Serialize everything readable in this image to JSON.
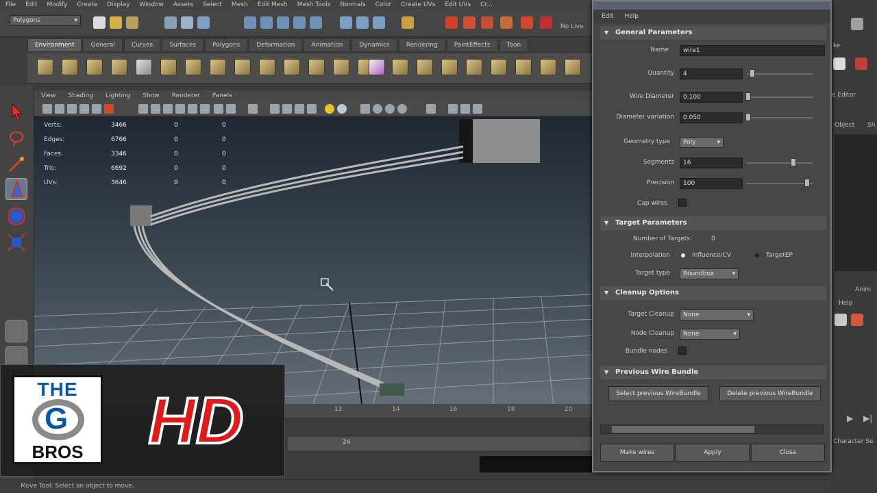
{
  "menubar": [
    "File",
    "Edit",
    "Modify",
    "Create",
    "Display",
    "Window",
    "Assets",
    "Select",
    "Mesh",
    "Edit Mesh",
    "Mesh Tools",
    "Normals",
    "Color",
    "Create UVs",
    "Edit UVs",
    "Cr..."
  ],
  "statusline": {
    "mode": "Polygons",
    "no_live": "No Live"
  },
  "shelf_tabs": [
    "Environment",
    "General",
    "Curves",
    "Surfaces",
    "Polygons",
    "Deformation",
    "Animation",
    "Dynamics",
    "Rendering",
    "PaintEffects",
    "Toon"
  ],
  "viewport": {
    "menu": [
      "View",
      "Shading",
      "Lighting",
      "Show",
      "Renderer",
      "Panels"
    ],
    "hud": [
      {
        "label": "Verts:",
        "value": "3466",
        "a": "0",
        "b": "0"
      },
      {
        "label": "Edges:",
        "value": "6766",
        "a": "0",
        "b": "0"
      },
      {
        "label": "Faces:",
        "value": "3346",
        "a": "0",
        "b": "0"
      },
      {
        "label": "Tris:",
        "value": "6692",
        "a": "0",
        "b": "0"
      },
      {
        "label": "UVs:",
        "value": "3646",
        "a": "0",
        "b": "0"
      }
    ]
  },
  "timeline": {
    "frames": [
      "12",
      "14",
      "16",
      "18",
      "20"
    ],
    "range_end": "24"
  },
  "helpline": "Move Tool: Select an object to move.",
  "logo": {
    "the": "THE",
    "g": "G",
    "bros": "BROS",
    "hd": "HD"
  },
  "right_panel": {
    "ke": "ke",
    "editor": "e Editor",
    "object": "Object",
    "sh": "Sh",
    "anim": "Anim",
    "help": "Help",
    "character": "Character Se"
  },
  "dialog": {
    "menu": [
      "Edit",
      "Help"
    ],
    "general": {
      "title": "General Parameters",
      "name_label": "Name",
      "name_value": "wire1",
      "quantity_label": "Quantity",
      "quantity_value": "4",
      "wire_diameter_label": "Wire Diameter",
      "wire_diameter_value": "0.100",
      "diameter_variation_label": "Diameter variation",
      "diameter_variation_value": "0.050",
      "geometry_type_label": "Geometry type",
      "geometry_type_value": "Poly",
      "segments_label": "Segments",
      "segments_value": "16",
      "precision_label": "Precision",
      "precision_value": "100",
      "cap_wires_label": "Cap wires"
    },
    "target": {
      "title": "Target Parameters",
      "num_targets_label": "Number of Targets:",
      "num_targets_value": "0",
      "interpolation_label": "Interpolation",
      "influence_label": "Influence/CV",
      "targetep_label": "TargetEP",
      "target_type_label": "Target type",
      "target_type_value": "Boundbox"
    },
    "cleanup": {
      "title": "Cleanup Options",
      "target_cleanup_label": "Target Cleanup",
      "target_cleanup_value": "None",
      "node_cleanup_label": "Node Cleanup",
      "node_cleanup_value": "None",
      "bundle_nodes_label": "Bundle nodes"
    },
    "previous": {
      "title": "Previous Wire Bundle",
      "select_button": "Select previous WireBundle",
      "delete_button": "Delete previous WireBundle"
    },
    "footer": {
      "make": "Make wires",
      "apply": "Apply",
      "close": "Close"
    }
  },
  "colors": {
    "accent_red": "#e01a1a",
    "logo_blue": "#0a57a8",
    "panel": "#474747"
  }
}
